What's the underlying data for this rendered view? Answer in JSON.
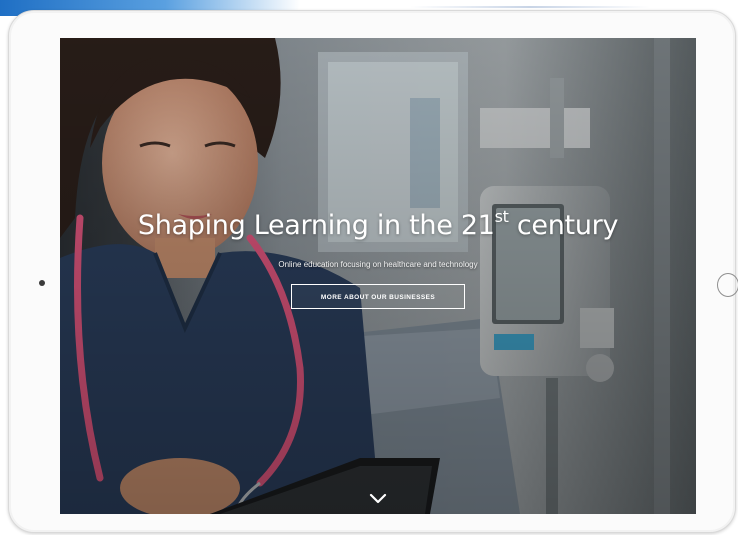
{
  "hero": {
    "title_main": "Shaping Learning in the 21",
    "title_sup": "st",
    "title_end": " century",
    "subtitle": "Online education focusing on healthcare and technology",
    "cta_label": "MORE ABOUT OUR BUSINESSES"
  },
  "icons": {
    "scroll_down": "chevron-down-icon"
  },
  "colors": {
    "accent_swoosh": "#1f6fc4",
    "scrubs": "#2b3f5e",
    "stethoscope": "#e0567e",
    "text_on_hero": "#ffffff"
  }
}
